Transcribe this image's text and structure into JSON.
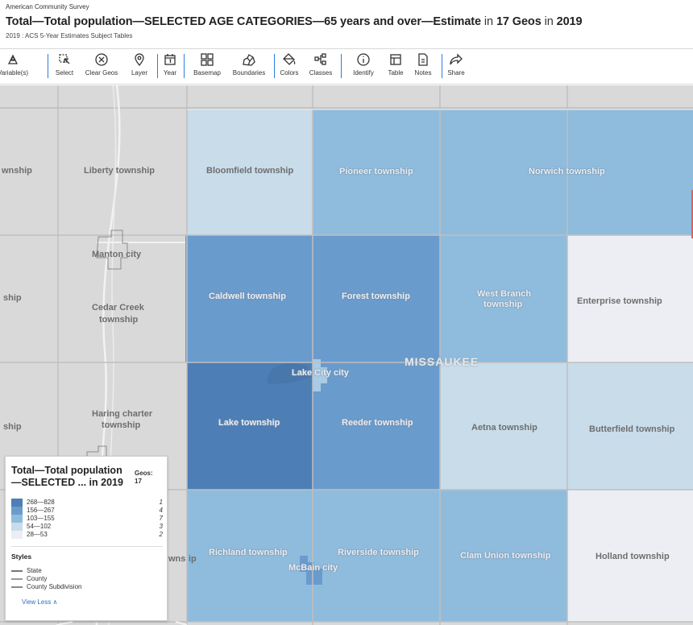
{
  "header": {
    "survey": "American Community Survey",
    "title": {
      "p1": "Total—Total population—SELECTED AGE CATEGORIES—65 years and over—Estimate",
      "p2": " in ",
      "p3": "17 Geos",
      "p4": " in ",
      "p5": "2019"
    },
    "subtitle": "2019 : ACS 5-Year Estimates Subject Tables"
  },
  "toolbar": {
    "items": [
      {
        "label": "Variable(s)",
        "icon": "variables-icon"
      },
      {
        "label": "Select",
        "icon": "select-icon"
      },
      {
        "label": "Clear Geos",
        "icon": "clear-icon"
      },
      {
        "label": "Layer",
        "icon": "pin-icon"
      },
      {
        "label": "Year",
        "icon": "calendar-icon"
      },
      {
        "label": "Basemap",
        "icon": "grid-icon"
      },
      {
        "label": "Boundaries",
        "icon": "boundaries-icon"
      },
      {
        "label": "Colors",
        "icon": "paint-bucket-icon"
      },
      {
        "label": "Classes",
        "icon": "classes-icon"
      },
      {
        "label": "Identify",
        "icon": "info-icon"
      },
      {
        "label": "Table",
        "icon": "table-icon"
      },
      {
        "label": "Notes",
        "icon": "notes-icon"
      },
      {
        "label": "Share",
        "icon": "share-icon"
      }
    ]
  },
  "map": {
    "county": "MISSAUKEE",
    "colors": {
      "class_5": "#4d7eb6",
      "class_4": "#6a9bcd",
      "class_3": "#8fbcdd",
      "class_2": "#c8dcea",
      "class_1": "#eceef4",
      "outside": "#d9d9d9"
    },
    "labels": {
      "lbl_nship": "wnship",
      "liberty": "Liberty township",
      "manton": "Manton city",
      "ship_w": "ship",
      "cedar_a": "Cedar Creek",
      "cedar_b": "township",
      "haring_a": "Haring charter",
      "haring_b": "township",
      "ship_w2": "ship",
      "bloomfield": "Bloomfield township",
      "pioneer": "Pioneer township",
      "norwich": "Norwich township",
      "caldwell": "Caldwell township",
      "forest": "Forest township",
      "westbranch_a": "West Branch",
      "westbranch_b": "township",
      "enterprise": "Enterprise township",
      "lakecity": "Lake City city",
      "lake": "Lake township",
      "reeder": "Reeder township",
      "aetna": "Aetna township",
      "butterfield": "Butterfield township",
      "richland_a": "wns",
      "richland_b": "ip",
      "richland": "Richland township",
      "riverside": "Riverside township",
      "mcbain": "McBain city",
      "clamunion": "Clam Union township",
      "holland": "Holland township"
    }
  },
  "legend": {
    "title_l1": "Total—Total population",
    "title_l2": "—SELECTED ... in 2019",
    "geos_label": "Geos:",
    "geos_count": "17",
    "classes": [
      {
        "range": "268—828",
        "count": "1",
        "color": "#4d7eb6"
      },
      {
        "range": "156—267",
        "count": "4",
        "color": "#6a9bcd"
      },
      {
        "range": "103—155",
        "count": "7",
        "color": "#8fbcdd"
      },
      {
        "range": "54—102",
        "count": "3",
        "color": "#c8dcea"
      },
      {
        "range": "28—53",
        "count": "2",
        "color": "#eceef4"
      }
    ],
    "styles_title": "Styles",
    "styles": [
      "State",
      "County",
      "County Subdivision"
    ],
    "view_less": "View Less ∧"
  }
}
